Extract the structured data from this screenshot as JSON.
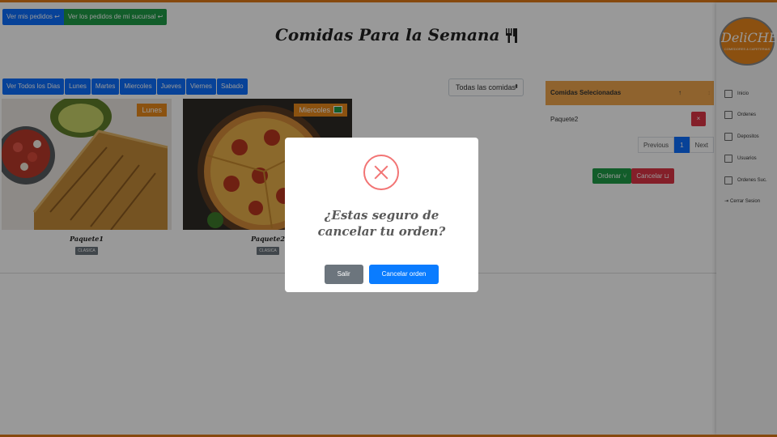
{
  "header": {
    "ver_mis_pedidos": "Ver mis pedidos",
    "ver_pedidos_sucursal": "Ver los pedidos de mi sucursal",
    "title": "Comidas Para la Semana"
  },
  "day_filter": {
    "buttons": [
      "Ver Todos los Dias",
      "Lunes",
      "Martes",
      "Miercoles",
      "Jueves",
      "Viernes",
      "Sabado"
    ],
    "select_value": "Todas las comidas"
  },
  "cards": [
    {
      "name": "Paquete1",
      "day": "Lunes",
      "tag": "CLASICA"
    },
    {
      "name": "Paquete2",
      "day": "Miercoles",
      "tag": "CLASICA"
    }
  ],
  "selected_panel": {
    "header": "Comidas Selecionadas",
    "sort_icon": "↑",
    "sort_icon2": "↕",
    "items": [
      {
        "name": "Paquete2"
      }
    ],
    "delete_label": "×",
    "pager": {
      "previous": "Previous",
      "page": "1",
      "next": "Next"
    },
    "ordenar_label": "Ordenar",
    "cancelar_label": "Cancelar"
  },
  "sidebar": {
    "logo_text": "DeliCHEF",
    "logo_sub": "COMEDORES & CAFETERIAS",
    "items": [
      "Inicio",
      "Ordenes",
      "Depositos",
      "Usuarios",
      "Ordenes Suc.",
      "Cerrar Sesion"
    ]
  },
  "modal": {
    "message": "¿Estas seguro de cancelar tu orden?",
    "salir_label": "Salir",
    "cancelar_orden_label": "Cancelar orden"
  },
  "colors": {
    "accent_orange": "#e07b18",
    "primary_blue": "#0d6efd",
    "success_green": "#1e9b46",
    "danger_red": "#dc3545",
    "error_icon": "#f27474"
  }
}
